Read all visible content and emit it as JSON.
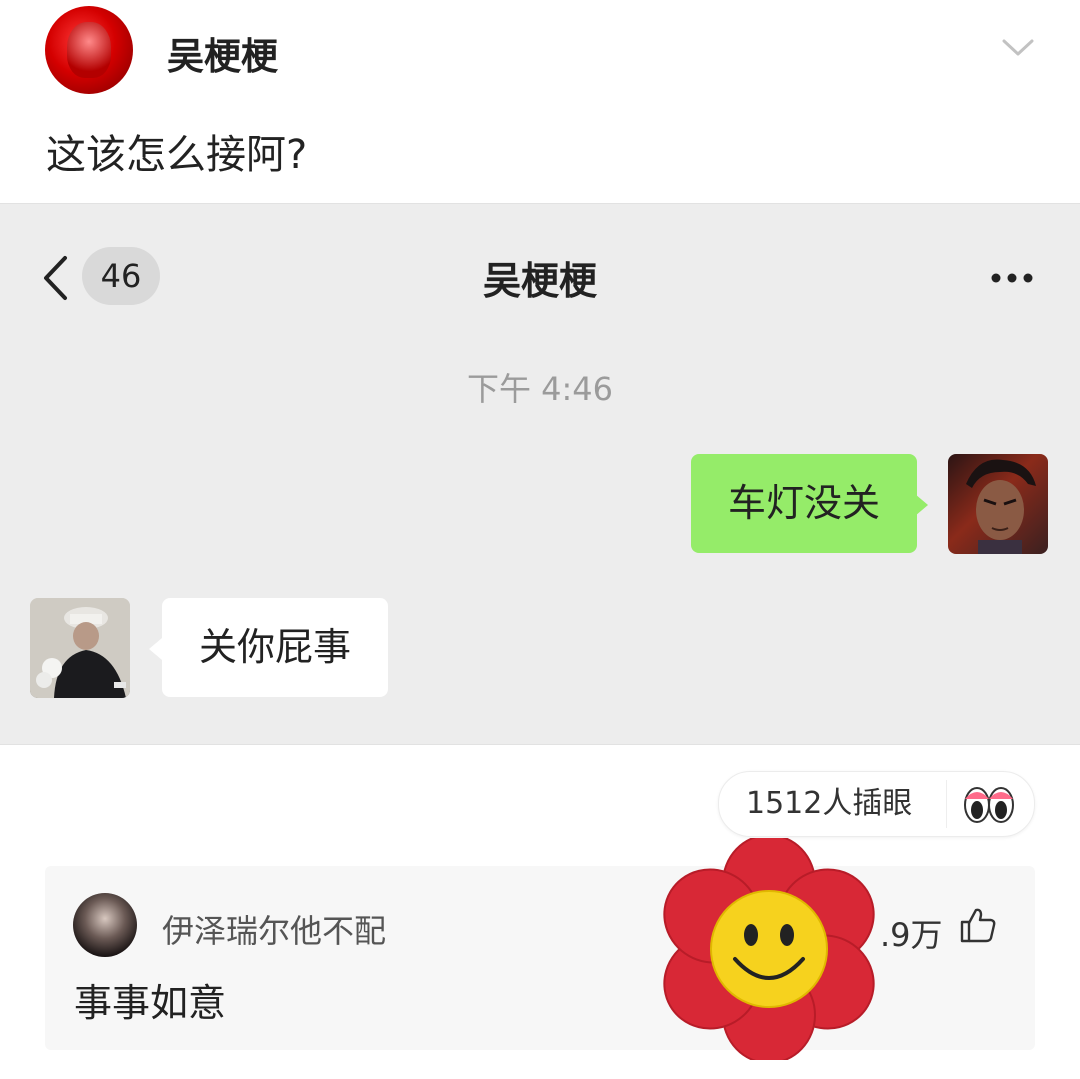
{
  "post": {
    "author": "吴梗梗",
    "text": "这该怎么接阿?"
  },
  "chat": {
    "unread_count": "46",
    "title": "吴梗梗",
    "time": "下午 4:46",
    "messages": [
      {
        "side": "right",
        "text": "车灯没关"
      },
      {
        "side": "left",
        "text": "关你屁事"
      }
    ]
  },
  "reaction": {
    "label": "1512人插眼",
    "icon": "eyes-icon"
  },
  "comment": {
    "author": "伊泽瑞尔他不配",
    "text": "事事如意",
    "likes": ".9万",
    "like_icon": "thumbs-up-icon"
  },
  "colors": {
    "chat_bg": "#ededed",
    "sent_bubble": "#95ec69",
    "received_bubble": "#ffffff",
    "time_text": "#9b9b9b"
  }
}
